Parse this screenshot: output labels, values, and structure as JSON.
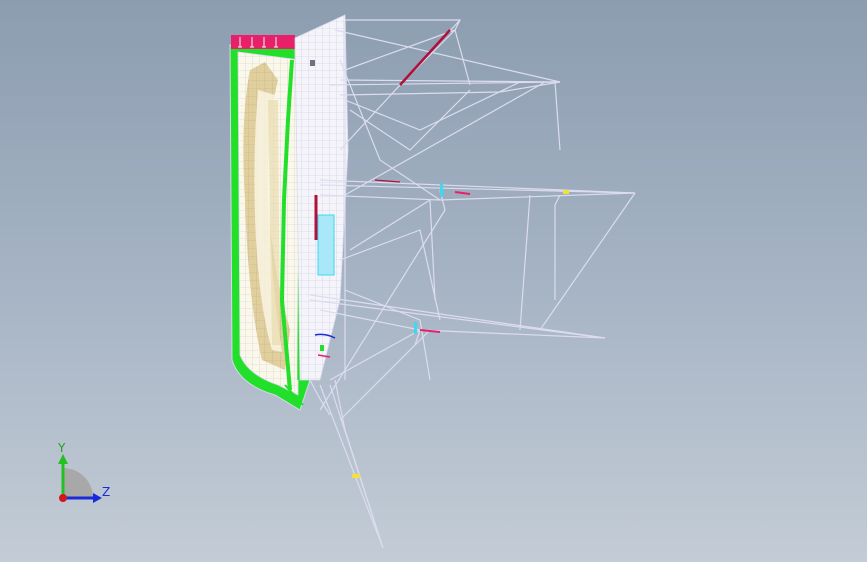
{
  "view": {
    "background_top": "#8c9db0",
    "background_bottom": "#c3ccd6"
  },
  "model": {
    "wire_color": "#dcdcf0",
    "hull_fill": "#fbf8ea",
    "frame_green": "#22e02a",
    "deck_magenta": "#e8206a",
    "timber_tan": "#d8c48a",
    "accent_red": "#b0103a",
    "accent_cyan": "#40d8f0",
    "accent_yellow": "#f0e040"
  },
  "triad": {
    "y_label": "Y",
    "z_label": "Z",
    "y_color": "#22c022",
    "z_color": "#1a2ad8",
    "origin_color": "#d01818"
  }
}
